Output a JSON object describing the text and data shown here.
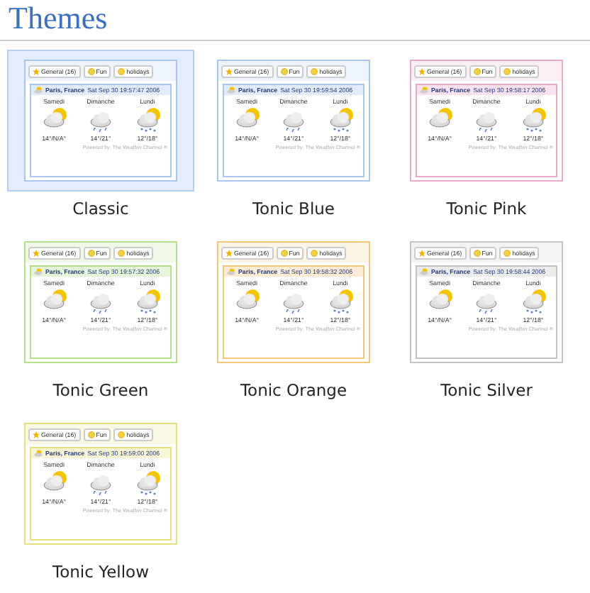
{
  "title": "Themes",
  "themes": [
    {
      "name": "Classic",
      "selected": true,
      "color": "#a9c6ee",
      "tabs": [
        "General (16)",
        "Fun",
        "holidays"
      ],
      "location": "Paris, France",
      "time": "Sat Sep 30 19:57:47 2006",
      "days": [
        {
          "day": "Samedi",
          "kind": "sun-cloud",
          "temp": "14°/N/A°"
        },
        {
          "day": "Dimanche",
          "kind": "rain",
          "temp": "14°/21°"
        },
        {
          "day": "Lundi",
          "kind": "snow",
          "temp": "12°/18°"
        }
      ],
      "footer": "Powered by: The Weather Channel ®"
    },
    {
      "name": "Tonic Blue",
      "selected": false,
      "color": "#a9c6ee",
      "tabs": [
        "General (16)",
        "Fun",
        "holidays"
      ],
      "location": "Paris, France",
      "time": "Sat Sep 30 19:59:54 2006",
      "days": [
        {
          "day": "Samedi",
          "kind": "sun-cloud",
          "temp": "14°/N/A°"
        },
        {
          "day": "Dimanche",
          "kind": "rain",
          "temp": "14°/21°"
        },
        {
          "day": "Lundi",
          "kind": "snow",
          "temp": "12°/18°"
        }
      ],
      "footer": "Powered by: The Weather Channel ®"
    },
    {
      "name": "Tonic Pink",
      "selected": false,
      "color": "#e9a9c9",
      "tabs": [
        "General (16)",
        "Fun",
        "holidays"
      ],
      "location": "Paris, France",
      "time": "Sat Sep 30 19:58:17 2006",
      "days": [
        {
          "day": "Samedi",
          "kind": "sun-cloud",
          "temp": "14°/N/A°"
        },
        {
          "day": "Dimanche",
          "kind": "rain",
          "temp": "14°/21°"
        },
        {
          "day": "Lundi",
          "kind": "snow",
          "temp": "12°/18°"
        }
      ],
      "footer": "Powered by: The Weather Channel ®"
    },
    {
      "name": "Tonic Green",
      "selected": false,
      "color": "#b5e08a",
      "tabs": [
        "General (16)",
        "Fun",
        "holidays"
      ],
      "location": "Paris, France",
      "time": "Sat Sep 30 19:57:32 2006",
      "days": [
        {
          "day": "Samedi",
          "kind": "sun-cloud",
          "temp": "14°/N/A°"
        },
        {
          "day": "Dimanche",
          "kind": "rain",
          "temp": "14°/21°"
        },
        {
          "day": "Lundi",
          "kind": "snow",
          "temp": "12°/18°"
        }
      ],
      "footer": "Powered by: The Weather Channel ®"
    },
    {
      "name": "Tonic Orange",
      "selected": false,
      "color": "#f2c77a",
      "tabs": [
        "General (16)",
        "Fun",
        "holidays"
      ],
      "location": "Paris, France",
      "time": "Sat Sep 30 19:58:32 2006",
      "days": [
        {
          "day": "Samedi",
          "kind": "sun-cloud",
          "temp": "14°/N/A°"
        },
        {
          "day": "Dimanche",
          "kind": "rain",
          "temp": "14°/21°"
        },
        {
          "day": "Lundi",
          "kind": "snow",
          "temp": "12°/18°"
        }
      ],
      "footer": "Powered by: The Weather Channel ®"
    },
    {
      "name": "Tonic Silver",
      "selected": false,
      "color": "#c4c4c4",
      "tabs": [
        "General (16)",
        "Fun",
        "holidays"
      ],
      "location": "Paris, France",
      "time": "Sat Sep 30 19:58:44 2006",
      "days": [
        {
          "day": "Samedi",
          "kind": "sun-cloud",
          "temp": "14°/N/A°"
        },
        {
          "day": "Dimanche",
          "kind": "rain",
          "temp": "14°/21°"
        },
        {
          "day": "Lundi",
          "kind": "snow",
          "temp": "12°/18°"
        }
      ],
      "footer": "Powered by: The Weather Channel ®"
    },
    {
      "name": "Tonic Yellow",
      "selected": false,
      "color": "#e6e07a",
      "tabs": [
        "General (16)",
        "Fun",
        "holidays"
      ],
      "location": "Paris, France",
      "time": "Sat Sep 30 19:59:00 2006",
      "days": [
        {
          "day": "Samedi",
          "kind": "sun-cloud",
          "temp": "14°/N/A°"
        },
        {
          "day": "Dimanche",
          "kind": "rain",
          "temp": "14°/21°"
        },
        {
          "day": "Lundi",
          "kind": "snow",
          "temp": "12°/18°"
        }
      ],
      "footer": "Powered by: The Weather Channel ®"
    }
  ]
}
